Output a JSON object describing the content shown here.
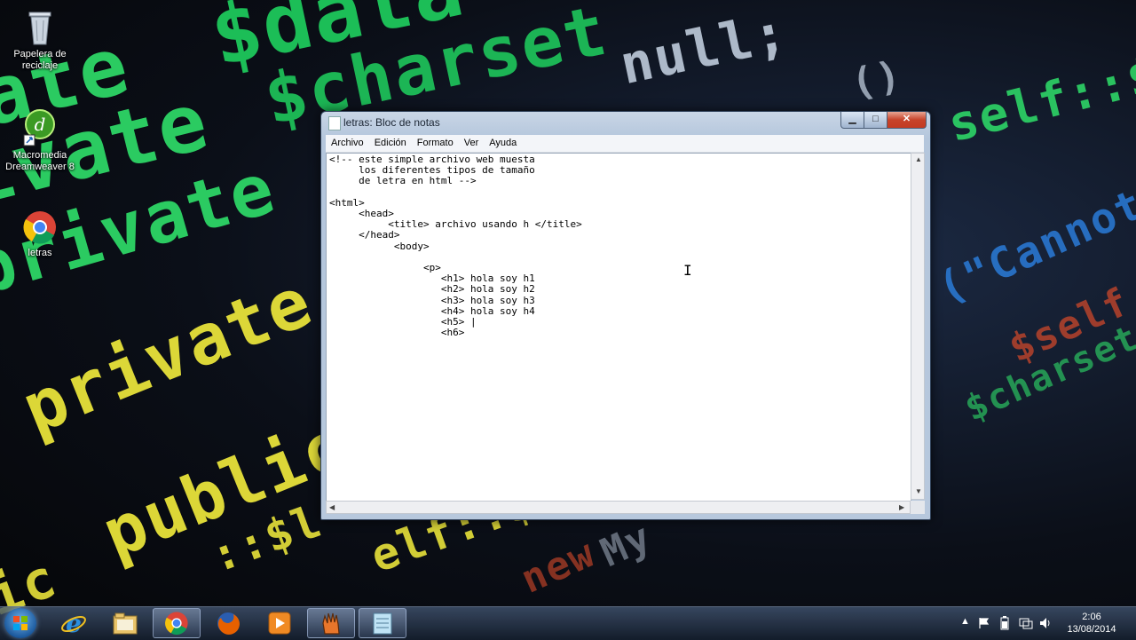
{
  "desktop": {
    "icons": [
      {
        "label": "Papelera de reciclaje",
        "icon": "recycle-bin-icon"
      },
      {
        "label": "Macromedia Dreamweaver 8",
        "icon": "dreamweaver-icon"
      },
      {
        "label": "letras",
        "icon": "chrome-icon"
      }
    ],
    "wallpaper_words": [
      "$data",
      "$charset",
      "null;",
      "()",
      "ate",
      "ivate",
      "private",
      "private",
      "public",
      "ic",
      "::$l",
      "elf::$l",
      "self::$ho",
      "(\"Cannot",
      "$charset",
      "$self",
      "new",
      "My"
    ]
  },
  "window": {
    "title": "letras: Bloc de notas",
    "menu": [
      "Archivo",
      "Edición",
      "Formato",
      "Ver",
      "Ayuda"
    ],
    "content": "<!-- este simple archivo web muesta\n     los diferentes tipos de tamaño\n     de letra en html -->\n\n<html>\n     <head>\n          <title> archivo usando h </title>\n     </head>\n           <body>\n\n                <p>\n                   <h1> hola soy h1\n                   <h2> hola soy h2\n                   <h3> hola soy h3\n                   <h4> hola soy h4\n                   <h5> |\n                   <h6>",
    "controls": {
      "minimize": "▁",
      "maximize": "□",
      "close": "✕"
    }
  },
  "taskbar": {
    "apps": [
      "internet-explorer-icon",
      "file-explorer-icon",
      "chrome-icon",
      "firefox-icon",
      "media-player-icon",
      "dreamweaver-hand-icon",
      "notepad-icon"
    ],
    "tray_icons": [
      "show-hidden-icon",
      "action-center-flag-icon",
      "battery-icon",
      "network-icon",
      "volume-icon"
    ],
    "time": "2:06",
    "date": "13/08/2014"
  },
  "colors": {
    "wallpaper_green": "#2fe06a",
    "wallpaper_yellow": "#e8e23a",
    "wallpaper_blue": "#2a7bd8",
    "close_red": "#c7432a"
  }
}
